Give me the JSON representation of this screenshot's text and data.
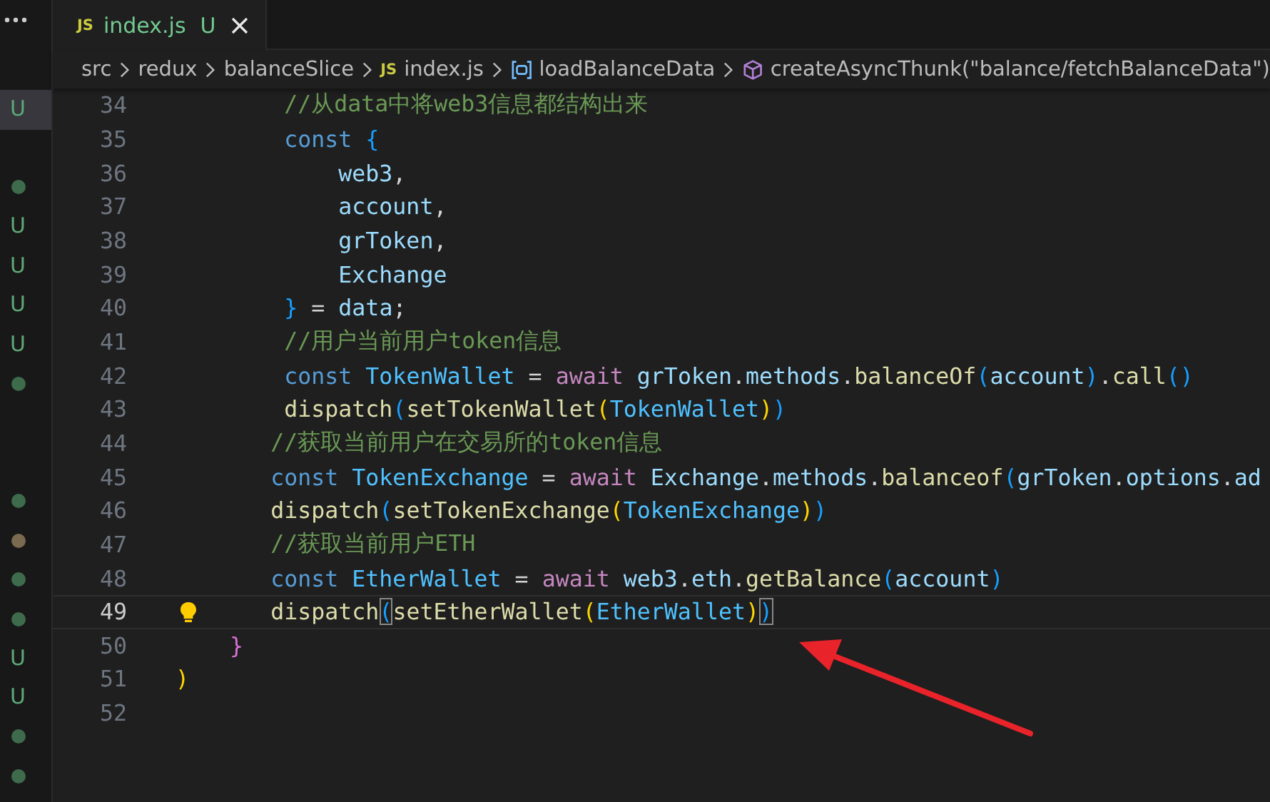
{
  "sidebar": {
    "groups": [
      {
        "items": [
          {
            "kind": "letter",
            "text": "U",
            "selected": true
          }
        ]
      },
      {
        "items": [
          {
            "kind": "dot",
            "color": "#3e6b4c",
            "selected": false
          },
          {
            "kind": "letter",
            "text": "U",
            "selected": false
          },
          {
            "kind": "letter",
            "text": "U",
            "selected": false
          },
          {
            "kind": "letter",
            "text": "U",
            "selected": false
          },
          {
            "kind": "letter",
            "text": "U",
            "selected": false
          },
          {
            "kind": "dot",
            "color": "#3e6b4c",
            "selected": false
          }
        ]
      },
      {
        "items": [
          {
            "kind": "dot",
            "color": "#3e6b4c",
            "selected": false
          },
          {
            "kind": "dot",
            "color": "#7a6a4f",
            "selected": false
          },
          {
            "kind": "dot",
            "color": "#3e6b4c",
            "selected": false
          },
          {
            "kind": "dot",
            "color": "#3e6b4c",
            "selected": false
          },
          {
            "kind": "letter",
            "text": "U",
            "selected": false
          },
          {
            "kind": "letter",
            "text": "U",
            "selected": false
          },
          {
            "kind": "dot",
            "color": "#3e6b4c",
            "selected": false
          },
          {
            "kind": "dot",
            "color": "#3e6b4c",
            "selected": false
          }
        ]
      }
    ]
  },
  "tabs": [
    {
      "badge": "JS",
      "label": "index.js",
      "status": "U",
      "selected": true
    }
  ],
  "breadcrumbs": [
    {
      "kind": "folder",
      "text": "src"
    },
    {
      "kind": "folder",
      "text": "redux"
    },
    {
      "kind": "folder",
      "text": "balanceSlice"
    },
    {
      "kind": "file",
      "badge": "JS",
      "text": "index.js"
    },
    {
      "kind": "variable",
      "text": "loadBalanceData"
    },
    {
      "kind": "module",
      "text": "createAsyncThunk(\"balance/fetchBalanceData\")"
    }
  ],
  "code_lines": [
    {
      "number": "34",
      "current": false,
      "lightbulb": false,
      "tokens": [
        {
          "kind": "cm",
          "text": "        //从data中将web3信息都结构出来"
        }
      ]
    },
    {
      "number": "35",
      "current": false,
      "lightbulb": false,
      "tokens": [
        {
          "kind": "kw",
          "text": "        const "
        },
        {
          "kind": "b3",
          "text": "{"
        }
      ]
    },
    {
      "number": "36",
      "current": false,
      "lightbulb": false,
      "tokens": [
        {
          "kind": "var",
          "text": "            web3"
        },
        {
          "kind": "p",
          "text": ","
        }
      ]
    },
    {
      "number": "37",
      "current": false,
      "lightbulb": false,
      "tokens": [
        {
          "kind": "var",
          "text": "            account"
        },
        {
          "kind": "p",
          "text": ","
        }
      ]
    },
    {
      "number": "38",
      "current": false,
      "lightbulb": false,
      "tokens": [
        {
          "kind": "var",
          "text": "            grToken"
        },
        {
          "kind": "p",
          "text": ","
        }
      ]
    },
    {
      "number": "39",
      "current": false,
      "lightbulb": false,
      "tokens": [
        {
          "kind": "var",
          "text": "            Exchange"
        }
      ]
    },
    {
      "number": "40",
      "current": false,
      "lightbulb": false,
      "tokens": [
        {
          "kind": "b3",
          "text": "        }"
        },
        {
          "kind": "p",
          "text": " = "
        },
        {
          "kind": "var",
          "text": "data"
        },
        {
          "kind": "p",
          "text": ";"
        }
      ]
    },
    {
      "number": "41",
      "current": false,
      "lightbulb": false,
      "tokens": [
        {
          "kind": "cm",
          "text": "        //用户当前用户token信息"
        }
      ]
    },
    {
      "number": "42",
      "current": false,
      "lightbulb": false,
      "tokens": [
        {
          "kind": "kw",
          "text": "        const "
        },
        {
          "kind": "cvar",
          "text": "TokenWallet"
        },
        {
          "kind": "p",
          "text": " = "
        },
        {
          "kind": "ctl",
          "text": "await "
        },
        {
          "kind": "var",
          "text": "grToken"
        },
        {
          "kind": "p",
          "text": "."
        },
        {
          "kind": "var",
          "text": "methods"
        },
        {
          "kind": "p",
          "text": "."
        },
        {
          "kind": "fn",
          "text": "balanceOf"
        },
        {
          "kind": "b3",
          "text": "("
        },
        {
          "kind": "var",
          "text": "account"
        },
        {
          "kind": "b3",
          "text": ")"
        },
        {
          "kind": "p",
          "text": "."
        },
        {
          "kind": "fn",
          "text": "call"
        },
        {
          "kind": "b3",
          "text": "()"
        }
      ]
    },
    {
      "number": "43",
      "current": false,
      "lightbulb": false,
      "tokens": [
        {
          "kind": "fn",
          "text": "        dispatch"
        },
        {
          "kind": "b3",
          "text": "("
        },
        {
          "kind": "fn",
          "text": "setTokenWallet"
        },
        {
          "kind": "b1",
          "text": "("
        },
        {
          "kind": "cvar",
          "text": "TokenWallet"
        },
        {
          "kind": "b1",
          "text": ")"
        },
        {
          "kind": "b3",
          "text": ")"
        }
      ]
    },
    {
      "number": "44",
      "current": false,
      "lightbulb": false,
      "tokens": [
        {
          "kind": "cm",
          "text": "       //获取当前用户在交易所的token信息"
        }
      ]
    },
    {
      "number": "45",
      "current": false,
      "lightbulb": false,
      "tokens": [
        {
          "kind": "kw",
          "text": "       const "
        },
        {
          "kind": "cvar",
          "text": "TokenExchange"
        },
        {
          "kind": "p",
          "text": " = "
        },
        {
          "kind": "ctl",
          "text": "await "
        },
        {
          "kind": "var",
          "text": "Exchange"
        },
        {
          "kind": "p",
          "text": "."
        },
        {
          "kind": "var",
          "text": "methods"
        },
        {
          "kind": "p",
          "text": "."
        },
        {
          "kind": "fn",
          "text": "balanceof"
        },
        {
          "kind": "b3",
          "text": "("
        },
        {
          "kind": "var",
          "text": "grToken"
        },
        {
          "kind": "p",
          "text": "."
        },
        {
          "kind": "var",
          "text": "options"
        },
        {
          "kind": "p",
          "text": "."
        },
        {
          "kind": "var",
          "text": "ad"
        }
      ]
    },
    {
      "number": "46",
      "current": false,
      "lightbulb": false,
      "tokens": [
        {
          "kind": "fn",
          "text": "       dispatch"
        },
        {
          "kind": "b3",
          "text": "("
        },
        {
          "kind": "fn",
          "text": "setTokenExchange"
        },
        {
          "kind": "b1",
          "text": "("
        },
        {
          "kind": "cvar",
          "text": "TokenExchange"
        },
        {
          "kind": "b1",
          "text": ")"
        },
        {
          "kind": "b3",
          "text": ")"
        }
      ]
    },
    {
      "number": "47",
      "current": false,
      "lightbulb": false,
      "tokens": [
        {
          "kind": "cm",
          "text": "       //获取当前用户ETH"
        }
      ]
    },
    {
      "number": "48",
      "current": false,
      "lightbulb": false,
      "tokens": [
        {
          "kind": "kw",
          "text": "       const "
        },
        {
          "kind": "cvar",
          "text": "EtherWallet"
        },
        {
          "kind": "p",
          "text": " = "
        },
        {
          "kind": "ctl",
          "text": "await "
        },
        {
          "kind": "var",
          "text": "web3"
        },
        {
          "kind": "p",
          "text": "."
        },
        {
          "kind": "var",
          "text": "eth"
        },
        {
          "kind": "p",
          "text": "."
        },
        {
          "kind": "fn",
          "text": "getBalance"
        },
        {
          "kind": "b3",
          "text": "("
        },
        {
          "kind": "var",
          "text": "account"
        },
        {
          "kind": "b3",
          "text": ")"
        }
      ]
    },
    {
      "number": "49",
      "current": true,
      "lightbulb": true,
      "tokens": [
        {
          "kind": "fn",
          "text": "       dispatch"
        },
        {
          "kind": "match",
          "text": "("
        },
        {
          "kind": "fn",
          "text": "setEtherWallet"
        },
        {
          "kind": "b1",
          "text": "("
        },
        {
          "kind": "cvar",
          "text": "EtherWallet"
        },
        {
          "kind": "b1",
          "text": ")"
        },
        {
          "kind": "match",
          "text": ")"
        }
      ]
    },
    {
      "number": "50",
      "current": false,
      "lightbulb": false,
      "tokens": [
        {
          "kind": "b2",
          "text": "    }"
        }
      ]
    },
    {
      "number": "51",
      "current": false,
      "lightbulb": false,
      "tokens": [
        {
          "kind": "b1",
          "text": ")"
        }
      ]
    },
    {
      "number": "52",
      "current": false,
      "lightbulb": false
    }
  ],
  "annotation": {
    "kind": "arrow"
  }
}
